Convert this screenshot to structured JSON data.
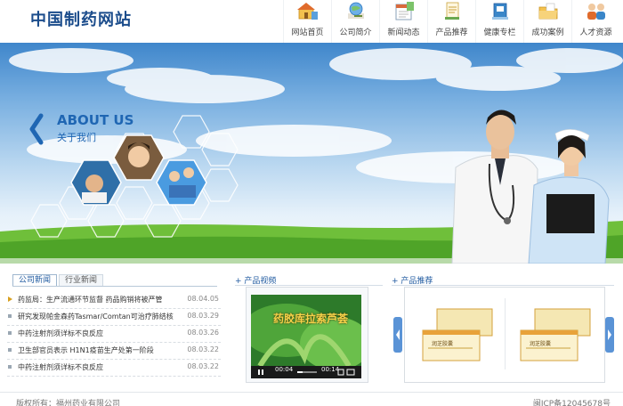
{
  "site": {
    "logo": "中国制药网站"
  },
  "nav": {
    "items": [
      {
        "label": "网站首页",
        "icon": "home-icon"
      },
      {
        "label": "公司简介",
        "icon": "globe-icon"
      },
      {
        "label": "新闻动态",
        "icon": "calendar-icon"
      },
      {
        "label": "产品推荐",
        "icon": "document-icon"
      },
      {
        "label": "健康专栏",
        "icon": "health-book-icon"
      },
      {
        "label": "成功案例",
        "icon": "folder-icon"
      },
      {
        "label": "人才资源",
        "icon": "people-icon"
      }
    ]
  },
  "banner": {
    "about_title": "ABOUT US",
    "about_subtitle": "关于我们"
  },
  "news": {
    "tabs": [
      {
        "label": "公司新闻",
        "active": true
      },
      {
        "label": "行业新闻",
        "active": false
      }
    ],
    "items": [
      {
        "title": "药监局：生产流通环节监督 药品购销将被严管",
        "date": "08.04.05"
      },
      {
        "title": "研究发现帕金森药Tasmar/Comtan可治疗肺结核",
        "date": "08.03.29"
      },
      {
        "title": "中药注射剂须详标不良反应",
        "date": "08.03.26"
      },
      {
        "title": "卫生部官员表示 H1N1疫苗生产处第一阶段",
        "date": "08.03.22"
      },
      {
        "title": "中药注射剂须详标不良反应",
        "date": "08.03.22"
      }
    ]
  },
  "video": {
    "section_title": "产品视频",
    "caption": "药胶库拉索芦荟",
    "time_current": "00:04",
    "time_total": "00:14"
  },
  "products": {
    "section_title": "产品推荐",
    "box_label_1": "润芝胶囊",
    "box_label_2": "润芝胶囊"
  },
  "footer": {
    "left": "版权所有：福州药业有限公司",
    "right": "闽ICP备12045678号"
  },
  "colors": {
    "brand_blue": "#1c4d8c",
    "link_blue": "#1f66b3",
    "grass_green": "#6fbf3a"
  }
}
